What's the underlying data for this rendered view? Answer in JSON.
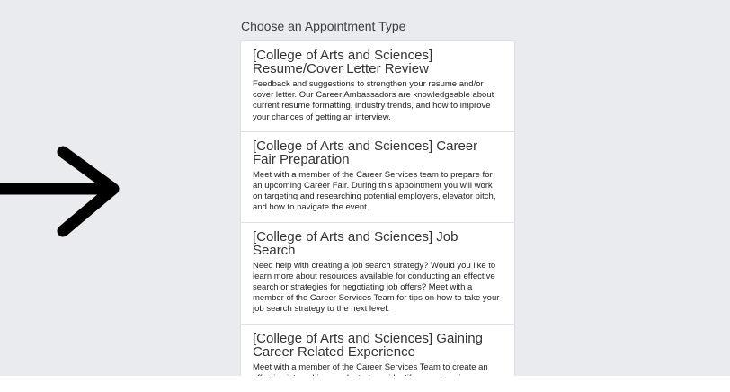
{
  "heading": "Choose an Appointment Type",
  "appointments": [
    {
      "title": "[College of Arts and Sciences] Resume/Cover Letter Review",
      "description": "Feedback and suggestions to strengthen your resume and/or cover letter. Our Career Ambassadors are knowledgeable about current resume formatting, industry trends, and how to improve your chances of getting an interview."
    },
    {
      "title": "[College of Arts and Sciences] Career Fair Preparation",
      "description": "Meet with a member of the Career Services team to prepare for an upcoming Career Fair. During this appointment you will work on targeting and researching potential employers, elevator pitch, and how to navigate the event."
    },
    {
      "title": "[College of Arts and Sciences] Job Search",
      "description": "Need help with creating a job search strategy? Would you like to learn more about resources available for conducting an effective search or strategies for negotiating job offers? Meet with a member of the Career Services Team for tips on how to take your job search strategy to the next level."
    },
    {
      "title": "[College of Arts and Sciences] Gaining Career Related Experience",
      "description": "Meet with a member of the Career Services Team to create an effective internship search strategy, identify ways to gain"
    }
  ],
  "colors": {
    "background": "#e9ebef",
    "card": "#ffffff",
    "border": "#dcdfe3",
    "arrow": "#000000"
  },
  "icons": {
    "arrow": "arrow-right-icon"
  }
}
